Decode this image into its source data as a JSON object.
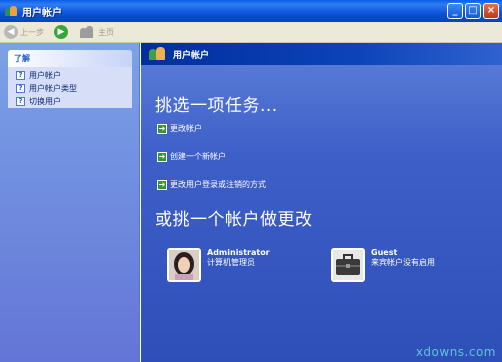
{
  "window": {
    "title": "用户帐户",
    "minimize_glyph": "_",
    "maximize_glyph": "□",
    "close_glyph": "×"
  },
  "toolbar": {
    "back_label": "上一步",
    "home_label": "主页"
  },
  "sidebar": {
    "section_title": "了解",
    "items": [
      {
        "label": "用户帐户",
        "icon": "help-icon"
      },
      {
        "label": "用户帐户类型",
        "icon": "help-icon"
      },
      {
        "label": "切换用户",
        "icon": "help-icon"
      }
    ]
  },
  "main": {
    "header_title": "用户帐户",
    "pick_heading": "挑选一项任务...",
    "tasks": [
      {
        "label": "更改帐户"
      },
      {
        "label": "创建一个新帐户"
      },
      {
        "label": "更改用户登录或注销的方式"
      }
    ],
    "or_heading": "或挑一个帐户做更改",
    "accounts": [
      {
        "name": "Administrator",
        "desc": "计算机管理员",
        "icon": "user-photo"
      },
      {
        "name": "Guest",
        "desc": "来宾帐户没有启用",
        "icon": "briefcase-icon"
      }
    ]
  },
  "watermark": "xdowns.com",
  "colors": {
    "titlebar": "#0b53d8",
    "sidebar": "#7ba2e7",
    "main_bg": "#3e5fc8",
    "header_bar": "#002e9e",
    "task_arrow": "#2f9a32"
  }
}
